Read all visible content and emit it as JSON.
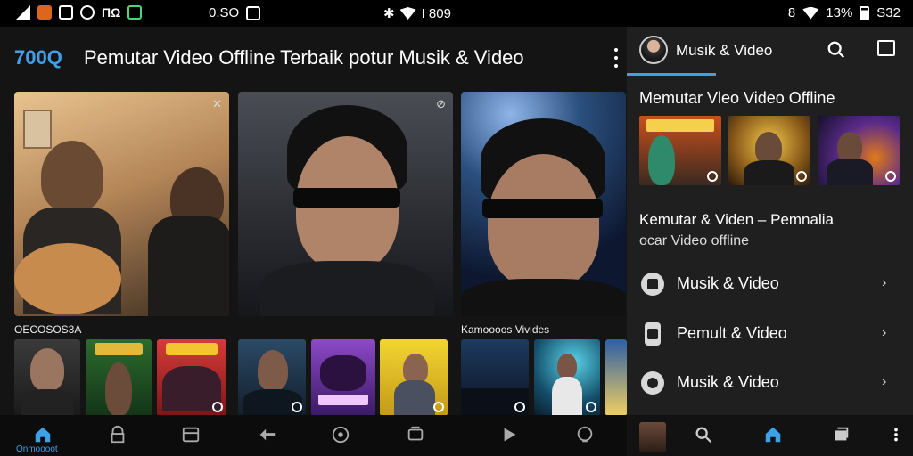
{
  "status_bar": {
    "left_text": "ΠΩ",
    "time_text": "0.SO",
    "center_text": "I 809",
    "battery_text": "13%",
    "clock_text": "S32"
  },
  "main": {
    "brand": "700Q",
    "title": "Pemutar Video Offline Terbaik potur Musik & Video",
    "section_left": "OECOSOS3A",
    "section_right": "Kamoooos Vivides",
    "bottom_home_label": "Onmoooot"
  },
  "side": {
    "header_title": "Musik & Video",
    "heading": "Memutar Vleo Video Offline",
    "desc_line1": "Kemutar & Viden – Pemnalia",
    "desc_line2": "ocar Video offline",
    "menu": [
      {
        "label": "Musik & Video",
        "icon": "tablet-icon"
      },
      {
        "label": "Pemult & Video",
        "icon": "lock-icon"
      },
      {
        "label": "Musik & Video",
        "icon": "person-icon"
      }
    ]
  },
  "colors": {
    "accent": "#3ea0e6",
    "background": "#141414",
    "side_background": "#1f1f1f"
  }
}
